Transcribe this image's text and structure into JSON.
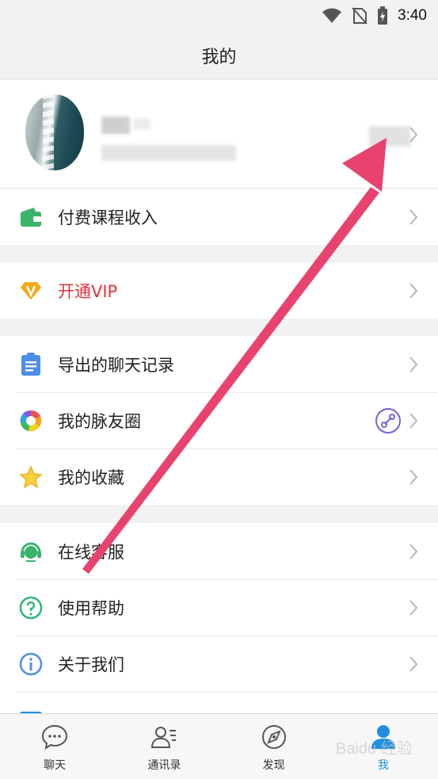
{
  "status_bar": {
    "time": "3:40"
  },
  "header": {
    "title": "我的"
  },
  "menu": {
    "group1": [
      {
        "label": "付费课程收入",
        "icon": "wallet-icon"
      }
    ],
    "group2": [
      {
        "label": "开通VIP",
        "icon": "vip-diamond-icon"
      }
    ],
    "group3": [
      {
        "label": "导出的聊天记录",
        "icon": "clipboard-icon"
      },
      {
        "label": "我的脉友圈",
        "icon": "aperture-icon"
      },
      {
        "label": "我的收藏",
        "icon": "star-icon"
      }
    ],
    "group4": [
      {
        "label": "在线客服",
        "icon": "headset-icon"
      },
      {
        "label": "使用帮助",
        "icon": "help-icon"
      },
      {
        "label": "关于我们",
        "icon": "info-icon"
      }
    ]
  },
  "tabbar": [
    {
      "label": "聊天",
      "icon": "chat-icon"
    },
    {
      "label": "通讯录",
      "icon": "contacts-icon"
    },
    {
      "label": "发现",
      "icon": "discover-icon"
    },
    {
      "label": "我",
      "icon": "me-icon",
      "active": true
    }
  ],
  "watermark": "Baidu 经验",
  "colors": {
    "accent": "#1f8fe0",
    "vip": "#e0333a",
    "arrow": "#e8436e"
  }
}
